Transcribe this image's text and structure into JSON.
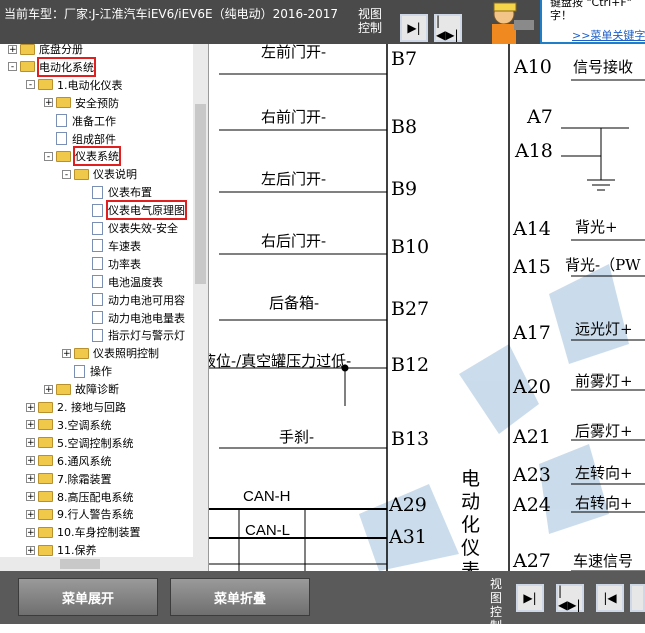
{
  "header": {
    "vehicle_label": "当前车型：厂家:J-江淮汽车iEV6/iEV6E（纯电动）2016-2017",
    "view_control": "视图控制",
    "tip": "键盘按 \"Ctrl+F\" 字！",
    "tip_link": ">>菜单关键字"
  },
  "tree": {
    "items": [
      {
        "label": "底盘分册",
        "level": 0,
        "type": "folder",
        "exp": "+"
      },
      {
        "label": "电动化系统",
        "level": 0,
        "type": "folder",
        "exp": "-",
        "highlight": true
      },
      {
        "label": "1.电动化仪表",
        "level": 1,
        "type": "folder",
        "exp": "-"
      },
      {
        "label": "安全预防",
        "level": 2,
        "type": "folder",
        "exp": "+"
      },
      {
        "label": "准备工作",
        "level": 2,
        "type": "doc",
        "exp": ""
      },
      {
        "label": "组成部件",
        "level": 2,
        "type": "doc",
        "exp": ""
      },
      {
        "label": "仪表系统",
        "level": 2,
        "type": "folder",
        "exp": "-",
        "highlight": true
      },
      {
        "label": "仪表说明",
        "level": 3,
        "type": "folder",
        "exp": "-"
      },
      {
        "label": "仪表布置",
        "level": 4,
        "type": "doc",
        "exp": ""
      },
      {
        "label": "仪表电气原理图",
        "level": 4,
        "type": "doc",
        "exp": "",
        "highlight": true
      },
      {
        "label": "仪表失效-安全",
        "level": 4,
        "type": "doc",
        "exp": ""
      },
      {
        "label": "车速表",
        "level": 4,
        "type": "doc",
        "exp": ""
      },
      {
        "label": "功率表",
        "level": 4,
        "type": "doc",
        "exp": ""
      },
      {
        "label": "电池温度表",
        "level": 4,
        "type": "doc",
        "exp": ""
      },
      {
        "label": "动力电池可用容",
        "level": 4,
        "type": "doc",
        "exp": ""
      },
      {
        "label": "动力电池电量表",
        "level": 4,
        "type": "doc",
        "exp": ""
      },
      {
        "label": "指示灯与警示灯",
        "level": 4,
        "type": "doc",
        "exp": ""
      },
      {
        "label": "仪表照明控制",
        "level": 3,
        "type": "folder",
        "exp": "+"
      },
      {
        "label": "操作",
        "level": 3,
        "type": "doc",
        "exp": ""
      },
      {
        "label": "故障诊断",
        "level": 2,
        "type": "folder",
        "exp": "+"
      },
      {
        "label": "2. 接地与回路",
        "level": 1,
        "type": "folder",
        "exp": "+"
      },
      {
        "label": "3.空调系统",
        "level": 1,
        "type": "folder",
        "exp": "+"
      },
      {
        "label": "5.空调控制系统",
        "level": 1,
        "type": "folder",
        "exp": "+"
      },
      {
        "label": "6.通风系统",
        "level": 1,
        "type": "folder",
        "exp": "+"
      },
      {
        "label": "7.除霜装置",
        "level": 1,
        "type": "folder",
        "exp": "+"
      },
      {
        "label": "8.高压配电系统",
        "level": 1,
        "type": "folder",
        "exp": "+"
      },
      {
        "label": "9.行人警告系统",
        "level": 1,
        "type": "folder",
        "exp": "+"
      },
      {
        "label": "10.车身控制装置",
        "level": 1,
        "type": "folder",
        "exp": "+"
      },
      {
        "label": "11.保养",
        "level": 1,
        "type": "folder",
        "exp": "+"
      }
    ]
  },
  "diagram": {
    "left_labels": [
      "左前门开-",
      "右前门开-",
      "左后门开-",
      "右后门开-",
      "后备箱-",
      "液位-/真空罐压力过低-",
      "手刹-",
      "CAN-H",
      "CAN-L"
    ],
    "left_pins": [
      "B7",
      "B8",
      "B9",
      "B10",
      "B27",
      "B12",
      "B13",
      "A29",
      "A31"
    ],
    "right_pins": [
      "A10",
      "A7",
      "A18",
      "A14",
      "A15",
      "A17",
      "A20",
      "A21",
      "A23",
      "A24",
      "A27"
    ],
    "right_labels": [
      "信号接收",
      "",
      "",
      "背光+",
      "背光-（PW",
      "远光灯+",
      "前雾灯+",
      "后雾灯+",
      "左转向+",
      "右转向+",
      "车速信号"
    ],
    "center_text": "电动化仪表"
  },
  "footer": {
    "expand_label": "菜单展开",
    "collapse_label": "菜单折叠",
    "view_control": "视图控制"
  },
  "colors": {
    "highlight": "#e02020",
    "bar": "#4a4a4a",
    "link": "#1e5fc8"
  }
}
